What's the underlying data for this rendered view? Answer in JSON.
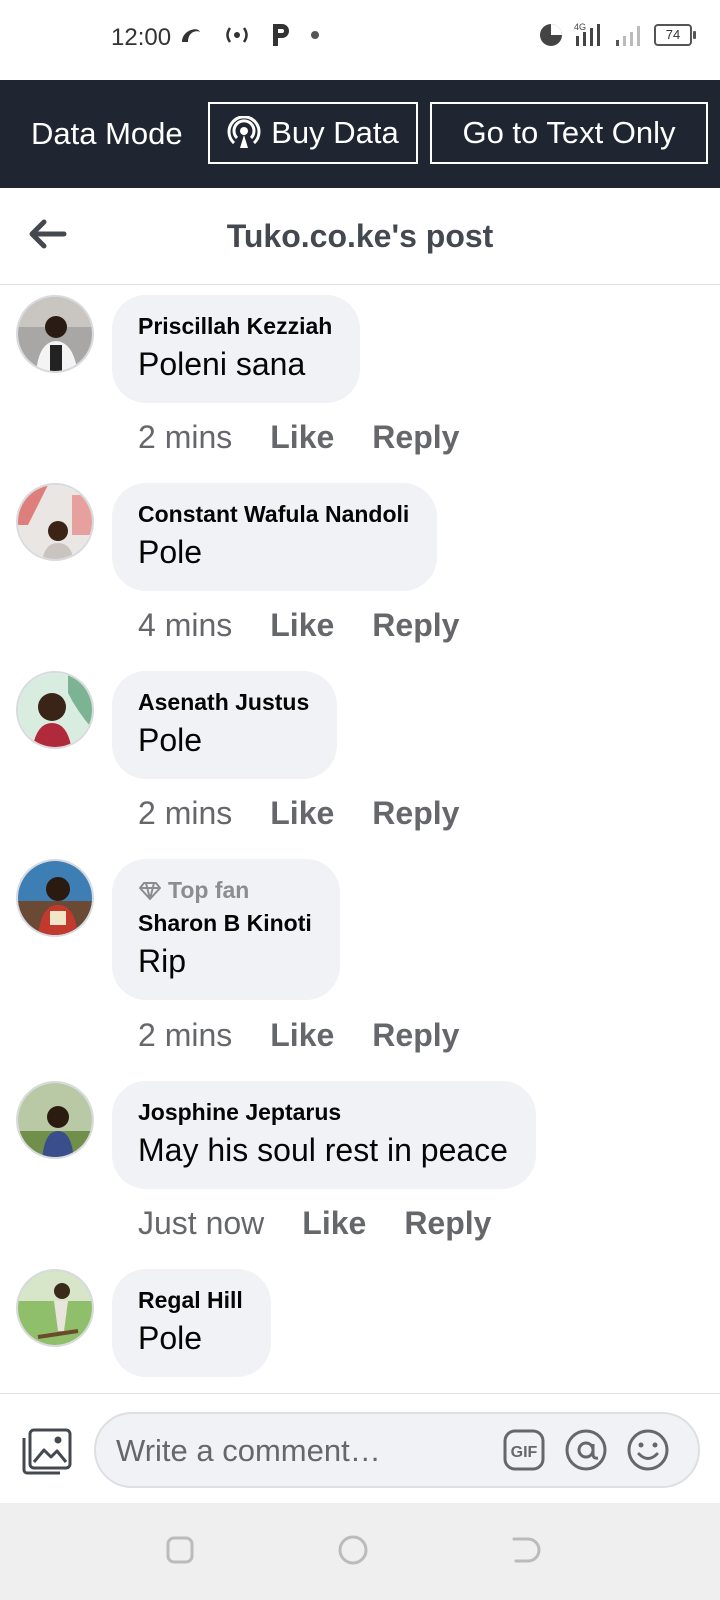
{
  "status_bar": {
    "time": "12:00",
    "network_label": "4G",
    "battery": "74"
  },
  "data_mode_bar": {
    "label": "Data Mode",
    "buy_data": "Buy Data",
    "text_only": "Go to Text Only"
  },
  "header": {
    "title": "Tuko.co.ke's post"
  },
  "comments": [
    {
      "name": "Priscillah Kezziah",
      "text": "Poleni sana",
      "time": "2 mins",
      "like": "Like",
      "reply": "Reply"
    },
    {
      "name": "Constant Wafula Nandoli",
      "text": "Pole",
      "time": "4 mins",
      "like": "Like",
      "reply": "Reply"
    },
    {
      "name": "Asenath Justus",
      "text": "Pole",
      "time": "2 mins",
      "like": "Like",
      "reply": "Reply"
    },
    {
      "badge": "Top fan",
      "name": "Sharon B Kinoti",
      "text": "Rip",
      "time": "2 mins",
      "like": "Like",
      "reply": "Reply"
    },
    {
      "name": "Josphine Jeptarus",
      "text": "May his soul rest in peace",
      "time": "Just now",
      "like": "Like",
      "reply": "Reply"
    },
    {
      "name": "Regal Hill",
      "text": "Pole"
    }
  ],
  "composer": {
    "placeholder": "Write a comment…",
    "gif_label": "GIF"
  },
  "colors": {
    "data_bar_bg": "#1f2631",
    "bubble_bg": "#f0f2f5",
    "secondary_text": "#65676b"
  }
}
